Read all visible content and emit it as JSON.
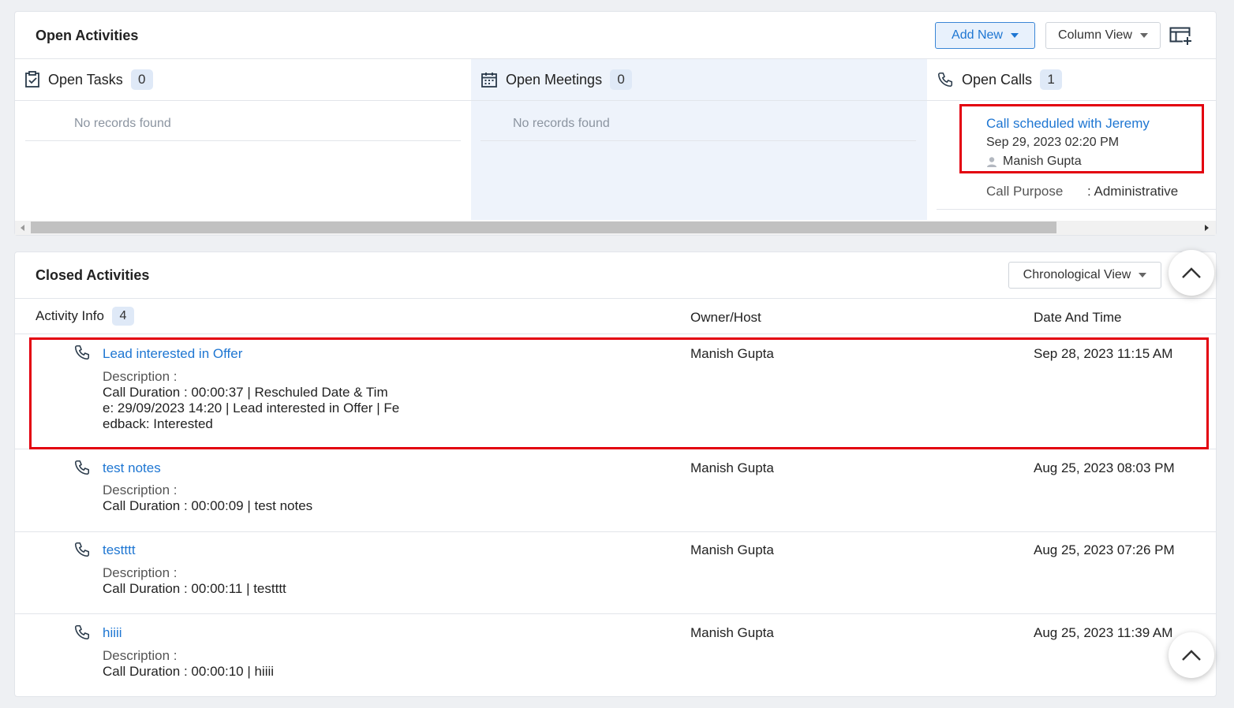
{
  "open_activities": {
    "title": "Open Activities",
    "add_new_label": "Add New",
    "view_select_label": "Column View",
    "columns": [
      {
        "label": "Open Tasks",
        "count": "0",
        "empty_text": "No records found"
      },
      {
        "label": "Open Meetings",
        "count": "0",
        "empty_text": "No records found"
      },
      {
        "label": "Open Calls",
        "count": "1"
      }
    ],
    "open_call": {
      "title": "Call scheduled with Jeremy",
      "datetime": "Sep 29, 2023 02:20 PM",
      "owner": "Manish Gupta",
      "purpose_label": "Call Purpose",
      "purpose_value": ": Administrative"
    }
  },
  "closed_activities": {
    "title": "Closed Activities",
    "view_select_label": "Chronological View",
    "headers": {
      "activity_info": "Activity Info",
      "activity_count": "4",
      "owner": "Owner/Host",
      "date": "Date And Time"
    },
    "rows": [
      {
        "title": "Lead interested in Offer",
        "description_label": "Description :",
        "description": "Call Duration : 00:00:37 | Reschuled Date & Tim\ne: 29/09/2023 14:20 | Lead interested in Offer | Fe\nedback: Interested",
        "owner": "Manish Gupta",
        "date": "Sep 28, 2023 11:15 AM"
      },
      {
        "title": "test notes",
        "description_label": "Description :",
        "description": "Call Duration : 00:00:09 | test notes",
        "owner": "Manish Gupta",
        "date": "Aug 25, 2023 08:03 PM"
      },
      {
        "title": "testttt",
        "description_label": "Description :",
        "description": "Call Duration : 00:00:11 | testttt",
        "owner": "Manish Gupta",
        "date": "Aug 25, 2023 07:26 PM"
      },
      {
        "title": "hiiii",
        "description_label": "Description :",
        "description": "Call Duration : 00:00:10 | hiiii",
        "owner": "Manish Gupta",
        "date": "Aug 25, 2023 11:39 AM"
      }
    ]
  },
  "icons": {
    "tasks": "task-check-icon",
    "meetings": "calendar-icon",
    "calls": "phone-icon",
    "customize": "table-add-column-icon",
    "scroll_top": "chevron-up-icon",
    "user": "user-icon"
  },
  "colors": {
    "accent": "#1e76d2",
    "highlight": "#e3000f",
    "meetings_bg": "#eef3fb"
  }
}
